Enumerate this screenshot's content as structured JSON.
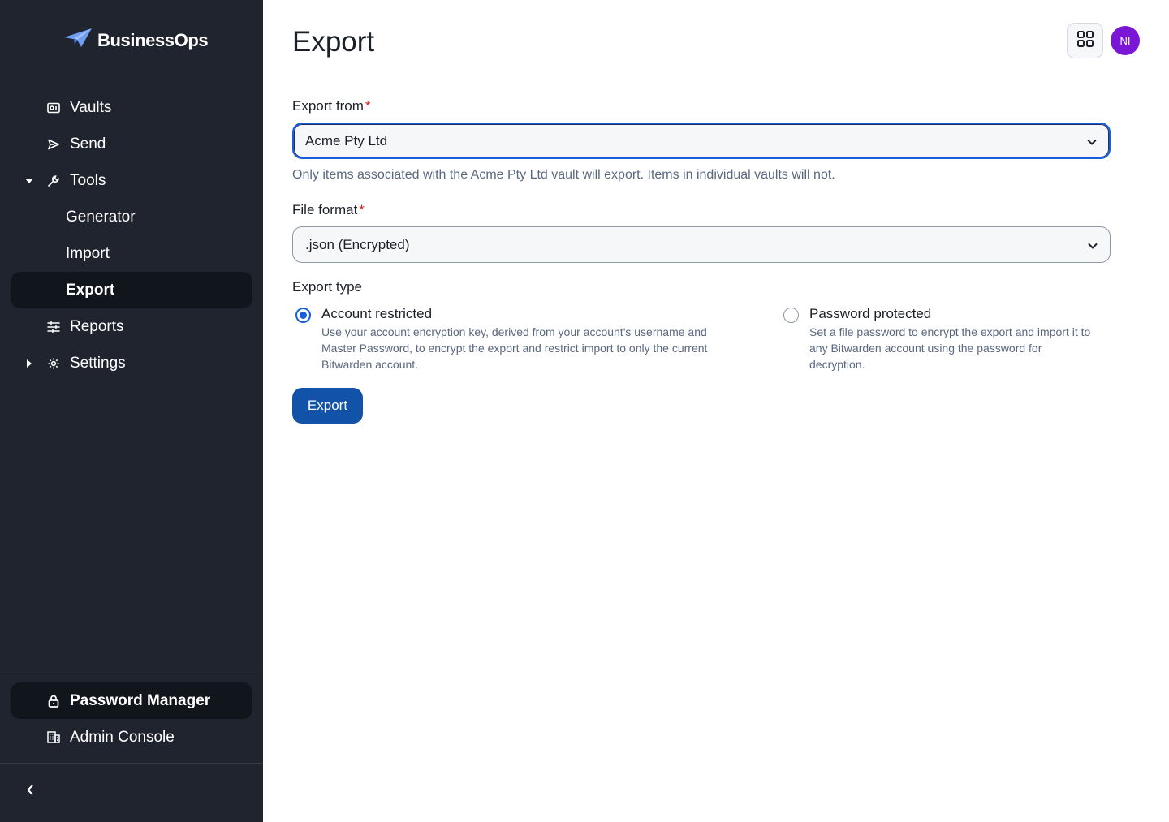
{
  "brand": {
    "name": "BusinessOps"
  },
  "sidebar": {
    "items": [
      {
        "label": "Vaults",
        "icon": "vault-icon"
      },
      {
        "label": "Send",
        "icon": "send-icon"
      },
      {
        "label": "Tools",
        "icon": "wrench-icon",
        "expanded": true
      },
      {
        "label": "Generator"
      },
      {
        "label": "Import"
      },
      {
        "label": "Export",
        "active": true
      },
      {
        "label": "Reports",
        "icon": "sliders-icon"
      },
      {
        "label": "Settings",
        "icon": "gear-icon",
        "expanded": false
      }
    ],
    "products": [
      {
        "label": "Password Manager",
        "icon": "lock-icon",
        "active": true
      },
      {
        "label": "Admin Console",
        "icon": "building-icon"
      }
    ],
    "collapse_icon": "chevron-left-icon"
  },
  "header": {
    "title": "Export",
    "apps_icon": "grid-icon",
    "avatar_initials": "NI",
    "avatar_color": "#7a17d6"
  },
  "form": {
    "export_from": {
      "label": "Export from",
      "required_mark": "*",
      "value": "Acme Pty Ltd",
      "hint": "Only items associated with the Acme Pty Ltd vault will export. Items in individual vaults will not."
    },
    "file_format": {
      "label": "File format",
      "required_mark": "*",
      "value": ".json (Encrypted)"
    },
    "export_type": {
      "label": "Export type",
      "options": [
        {
          "title": "Account restricted",
          "description": "Use your account encryption key, derived from your account's username and Master Password, to encrypt the export and restrict import to only the current Bitwarden account.",
          "checked": true
        },
        {
          "title": "Password protected",
          "description": "Set a file password to encrypt the export and import it to any Bitwarden account using the password for decryption.",
          "checked": false
        }
      ]
    },
    "submit_label": "Export"
  },
  "colors": {
    "sidebar_bg": "#1f242e",
    "primary": "#175ddc",
    "button": "#1252a8",
    "required": "#c21d1d"
  }
}
